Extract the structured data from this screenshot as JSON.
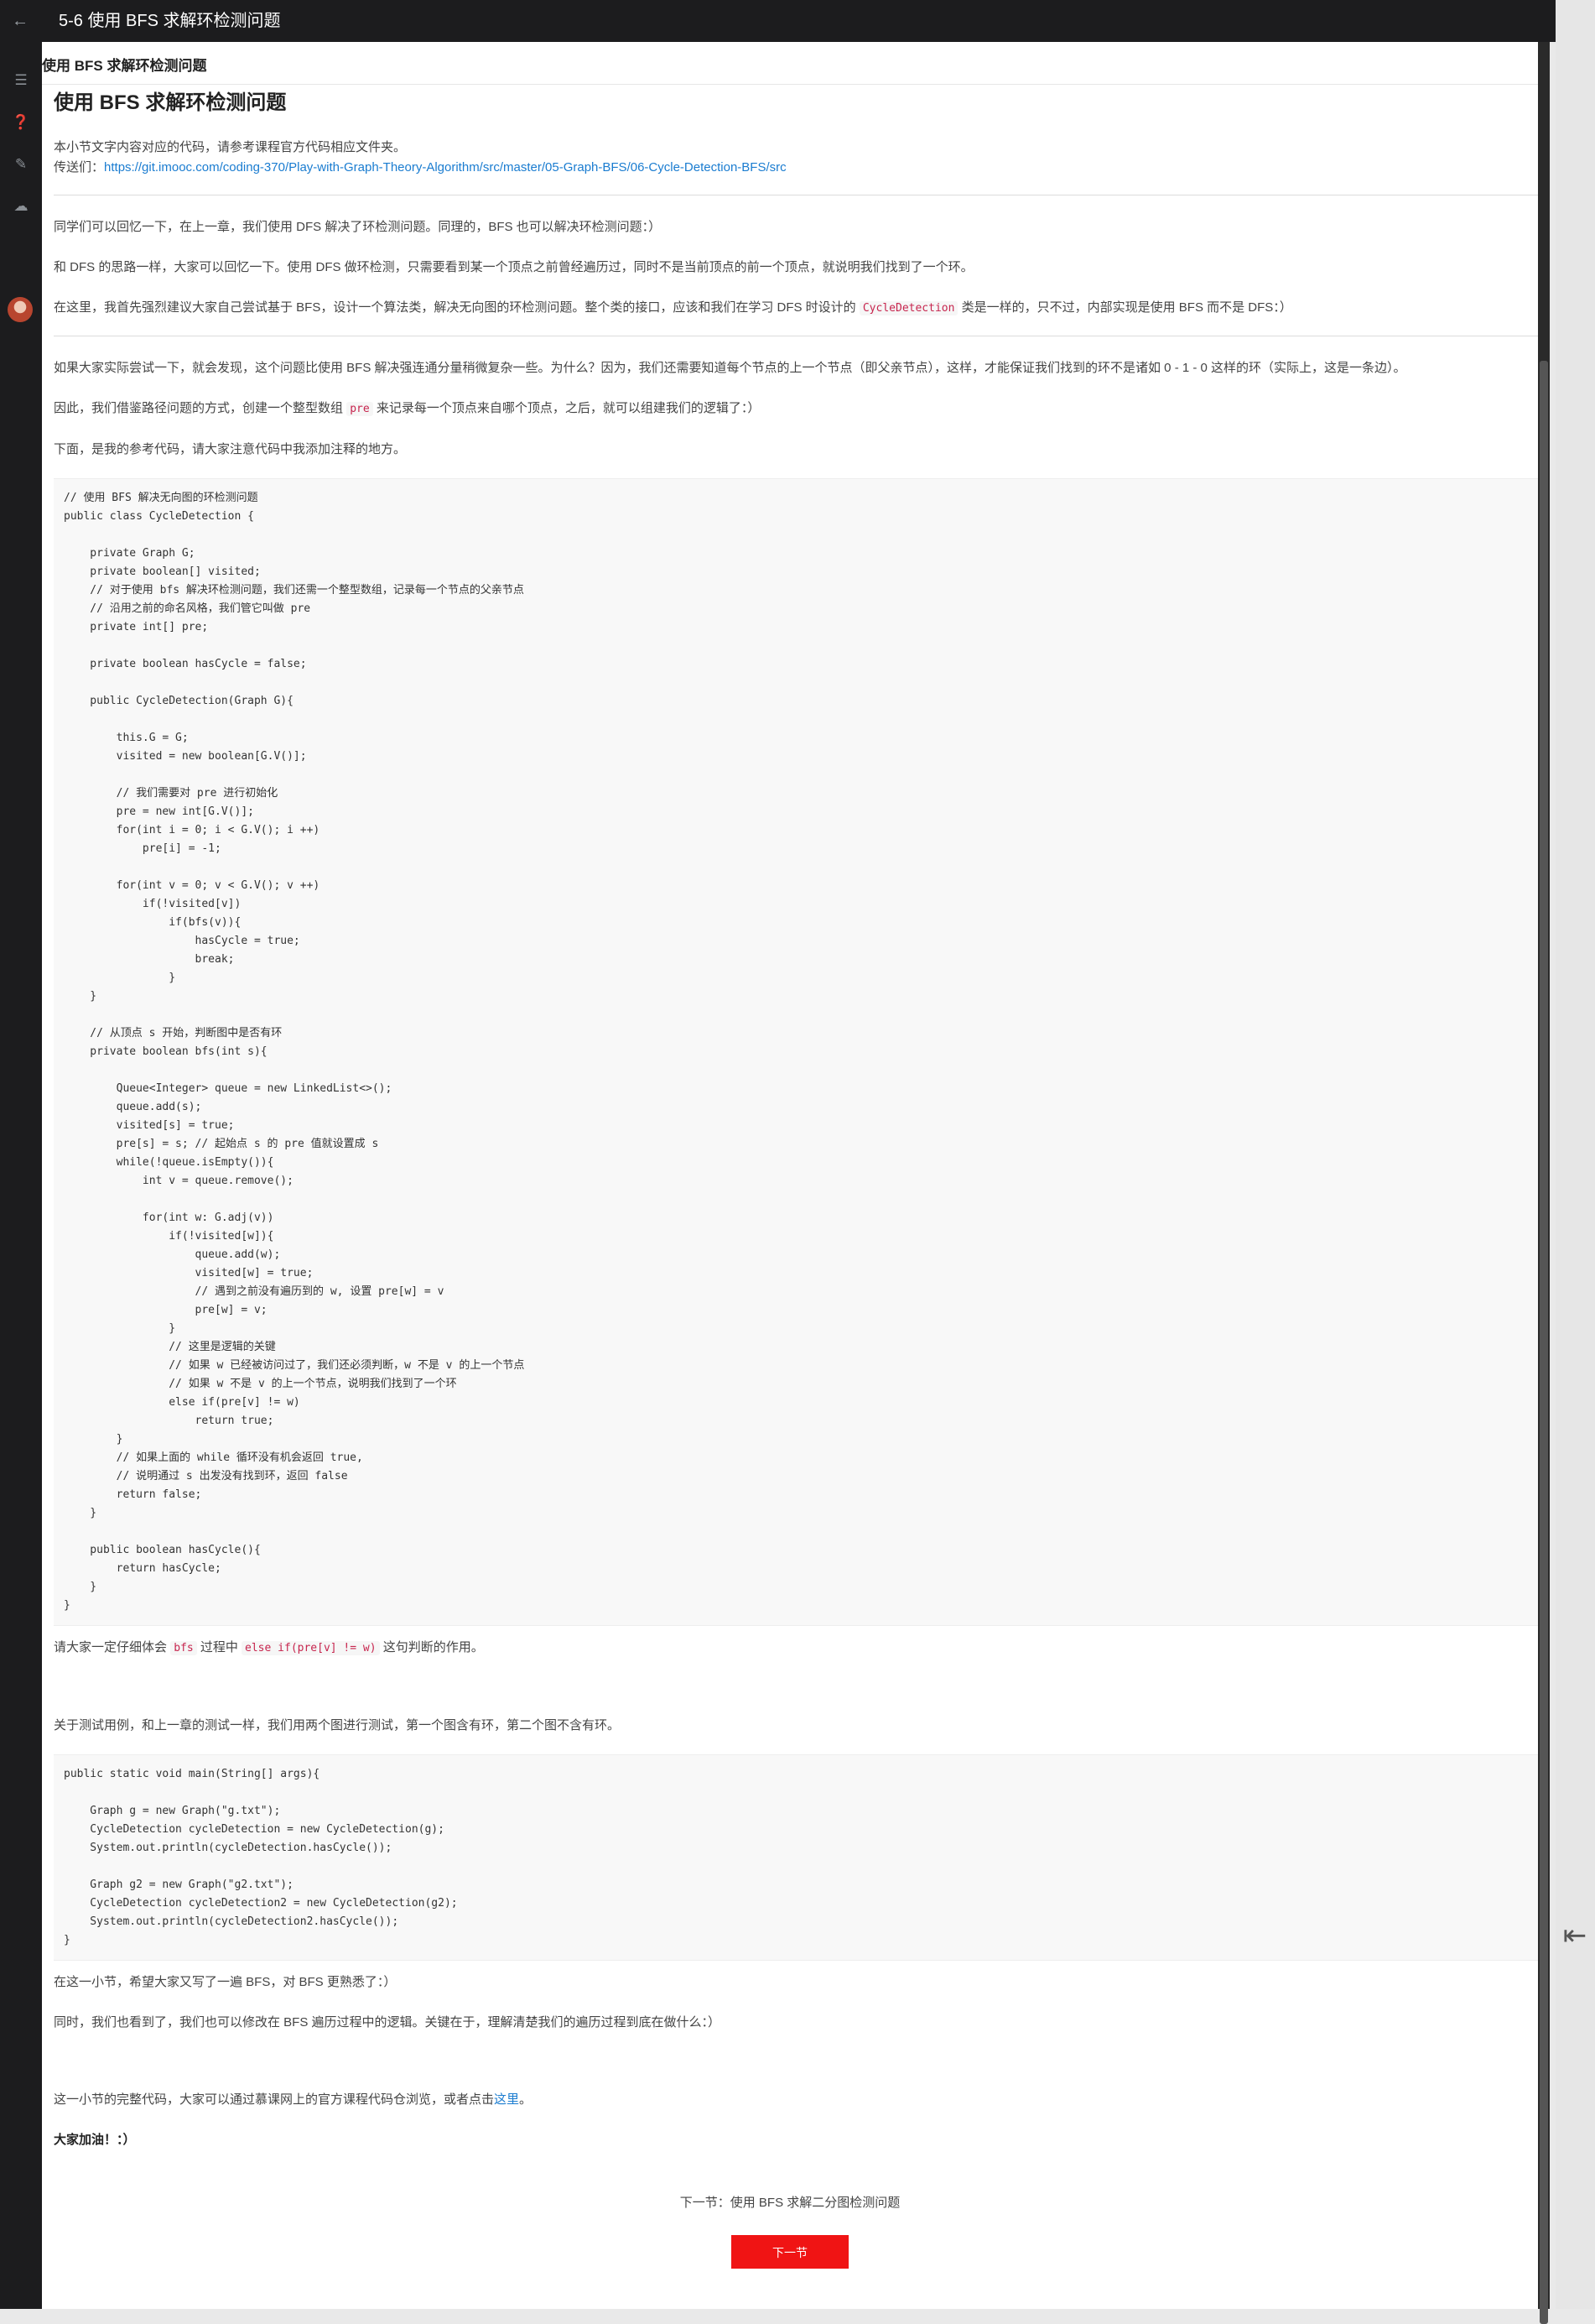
{
  "window": {
    "title": "5-6 使用 BFS 求解环检测问题"
  },
  "toc_title": "使用 BFS 求解环检测问题",
  "article": {
    "title": "使用 BFS 求解环检测问题",
    "intro_1": "本小节文字内容对应的代码，请参考课程官方代码相应文件夹。",
    "intro_2_prefix": "传送们：",
    "repo_link": "https://git.imooc.com/coding-370/Play-with-Graph-Theory-Algorithm/src/master/05-Graph-BFS/06-Cycle-Detection-BFS/src",
    "para_1": "同学们可以回忆一下，在上一章，我们使用 DFS 解决了环检测问题。同理的，BFS 也可以解决环检测问题：）",
    "para_2": "和 DFS 的思路一样，大家可以回忆一下。使用 DFS 做环检测，只需要看到某一个顶点之前曾经遍历过，同时不是当前顶点的前一个顶点，就说明我们找到了一个环。",
    "para_3_a": "在这里，我首先强烈建议大家自己尝试基于 BFS，设计一个算法类，解决无向图的环检测问题。整个类的接口，应该和我们在学习 DFS 时设计的",
    "para_3_code": "CycleDetection",
    "para_3_b": "类是一样的，只不过，内部实现是使用 BFS 而不是 DFS：）",
    "para_4": "如果大家实际尝试一下，就会发现，这个问题比使用 BFS 解决强连通分量稍微复杂一些。为什么？因为，我们还需要知道每个节点的上一个节点（即父亲节点），这样，才能保证我们找到的环不是诸如 0 - 1 - 0 这样的环（实际上，这是一条边）。",
    "para_5_a": "因此，我们借鉴路径问题的方式，创建一个整型数组",
    "para_5_code": "pre",
    "para_5_b": "来记录每一个顶点来自哪个顶点，之后，就可以组建我们的逻辑了：）",
    "para_6": "下面，是我的参考代码，请大家注意代码中我添加注释的地方。",
    "code_1": "// 使用 BFS 解决无向图的环检测问题\npublic class CycleDetection {\n\n    private Graph G;\n    private boolean[] visited;\n    // 对于使用 bfs 解决环检测问题，我们还需一个整型数组，记录每一个节点的父亲节点\n    // 沿用之前的命名风格，我们管它叫做 pre\n    private int[] pre;\n\n    private boolean hasCycle = false;\n\n    public CycleDetection(Graph G){\n\n        this.G = G;\n        visited = new boolean[G.V()];\n\n        // 我们需要对 pre 进行初始化\n        pre = new int[G.V()];\n        for(int i = 0; i < G.V(); i ++)\n            pre[i] = -1;\n\n        for(int v = 0; v < G.V(); v ++)\n            if(!visited[v])\n                if(bfs(v)){\n                    hasCycle = true;\n                    break;\n                }\n    }\n\n    // 从顶点 s 开始，判断图中是否有环\n    private boolean bfs(int s){\n\n        Queue<Integer> queue = new LinkedList<>();\n        queue.add(s);\n        visited[s] = true;\n        pre[s] = s; // 起始点 s 的 pre 值就设置成 s\n        while(!queue.isEmpty()){\n            int v = queue.remove();\n\n            for(int w: G.adj(v))\n                if(!visited[w]){\n                    queue.add(w);\n                    visited[w] = true;\n                    // 遇到之前没有遍历到的 w, 设置 pre[w] = v\n                    pre[w] = v;\n                }\n                // 这里是逻辑的关键\n                // 如果 w 已经被访问过了，我们还必须判断，w 不是 v 的上一个节点\n                // 如果 w 不是 v 的上一个节点，说明我们找到了一个环\n                else if(pre[v] != w)\n                    return true;\n        }\n        // 如果上面的 while 循环没有机会返回 true,\n        // 说明通过 s 出发没有找到环，返回 false\n        return false;\n    }\n\n    public boolean hasCycle(){\n        return hasCycle;\n    }\n}",
    "para_7_a": "请大家一定仔细体会",
    "para_7_code_1": "bfs",
    "para_7_b": "过程中",
    "para_7_code_2": "else if(pre[v] != w)",
    "para_7_c": "这句判断的作用。",
    "para_8": "关于测试用例，和上一章的测试一样，我们用两个图进行测试，第一个图含有环，第二个图不含有环。",
    "code_2": "public static void main(String[] args){\n\n    Graph g = new Graph(\"g.txt\");\n    CycleDetection cycleDetection = new CycleDetection(g);\n    System.out.println(cycleDetection.hasCycle());\n\n    Graph g2 = new Graph(\"g2.txt\");\n    CycleDetection cycleDetection2 = new CycleDetection(g2);\n    System.out.println(cycleDetection2.hasCycle());\n}",
    "para_9": "在这一小节，希望大家又写了一遍 BFS，对 BFS 更熟悉了：）",
    "para_10": "同时，我们也看到了，我们也可以修改在 BFS 遍历过程中的逻辑。关键在于，理解清楚我们的遍历过程到底在做什么：）",
    "para_11_a": "这一小节的完整代码，大家可以通过慕课网上的官方课程代码仓浏览，或者点击",
    "para_11_link": "这里",
    "para_11_b": "。",
    "para_12": "大家加油！：）"
  },
  "footer": {
    "next_label": "下一节：使用 BFS 求解二分图检测问题",
    "next_button": "下一节"
  },
  "colors": {
    "accent_red": "#f01414",
    "link_blue": "#1a7cd0",
    "chrome_dark": "#1c1c1e"
  }
}
